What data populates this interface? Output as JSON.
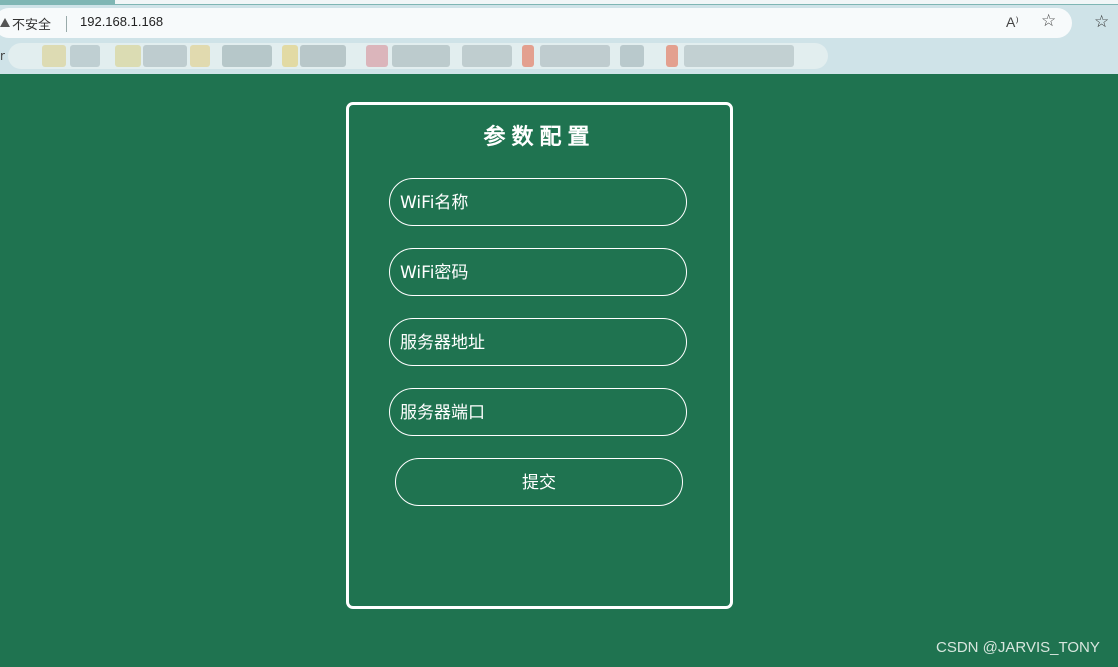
{
  "browser": {
    "security_label": "不安全",
    "url": "192.168.1.168",
    "read_aloud_label": "A⁾"
  },
  "bookmarks": {
    "first_char": "r"
  },
  "form": {
    "title": "参数配置",
    "fields": [
      {
        "label": "WiFi名称"
      },
      {
        "label": "WiFi密码"
      },
      {
        "label": "服务器地址"
      },
      {
        "label": "服务器端口"
      }
    ],
    "submit_label": "提交"
  },
  "watermark": "CSDN @JARVIS_TONY",
  "colors": {
    "background": "#1f7350",
    "panel_border": "#ffffff",
    "text": "#ffffff"
  }
}
